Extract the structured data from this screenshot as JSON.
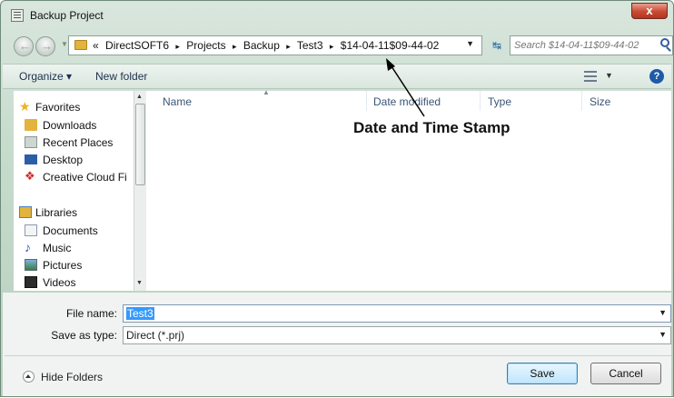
{
  "window": {
    "title": "Backup Project",
    "close_label": "x"
  },
  "address_bar": {
    "prefix": "«",
    "breadcrumb": [
      "DirectSOFT6",
      "Projects",
      "Backup",
      "Test3",
      "$14-04-11$09-44-02"
    ],
    "separator": "▸"
  },
  "search": {
    "placeholder": "Search $14-04-11$09-44-02"
  },
  "toolbar": {
    "organize": "Organize ▾",
    "new_folder": "New folder"
  },
  "sidebar": {
    "favorites": {
      "label": "Favorites",
      "items": [
        "Downloads",
        "Recent Places",
        "Desktop",
        "Creative Cloud Fi"
      ]
    },
    "libraries": {
      "label": "Libraries",
      "items": [
        "Documents",
        "Music",
        "Pictures",
        "Videos"
      ]
    }
  },
  "columns": [
    "Name",
    "Date modified",
    "Type",
    "Size"
  ],
  "annotation": "Date and Time Stamp",
  "form": {
    "file_name_label": "File name:",
    "file_name_value": "Test3",
    "save_as_type_label": "Save as type:",
    "save_as_type_value": "Direct (*.prj)"
  },
  "footer": {
    "hide_folders": "Hide Folders",
    "save": "Save",
    "cancel": "Cancel"
  },
  "colors": {
    "selection": "#3399ff",
    "titlebar": "#c5dbcc",
    "folder": "#e2b33d"
  }
}
